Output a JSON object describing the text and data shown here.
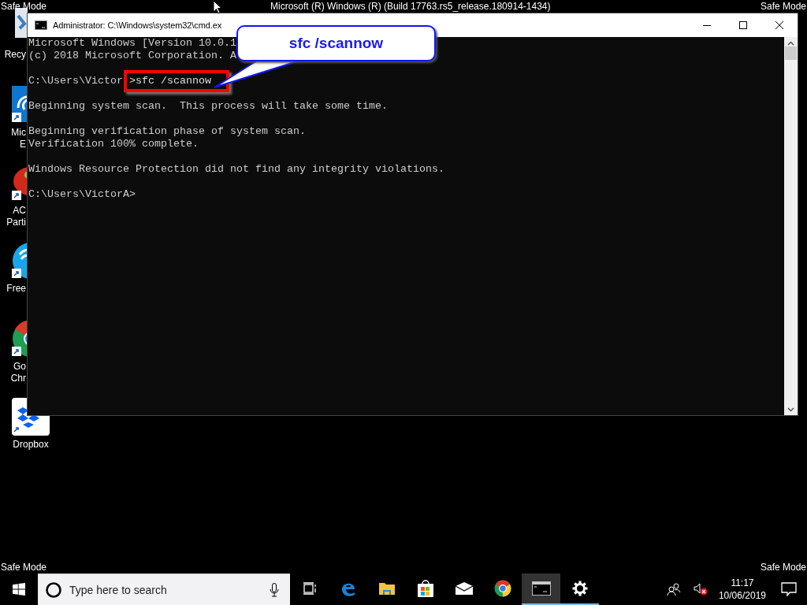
{
  "desktop": {
    "corner_top_left": "Safe Mode",
    "build": "Microsoft (R) Windows (R) (Build 17763.rs5_release.180914-1434)",
    "corner_top_right": "Safe Mode",
    "corner_bottom_left": "Safe Mode",
    "corner_bottom_right": "Safe Mode",
    "icons": [
      {
        "kind": "recycle",
        "label_lines": [
          "Recy"
        ]
      },
      {
        "kind": "edge",
        "label_lines": [
          "Mic",
          "E"
        ]
      },
      {
        "kind": "partition",
        "label_lines": [
          "AC",
          "Parti"
        ]
      },
      {
        "kind": "wifi",
        "label_lines": [
          "Free"
        ]
      },
      {
        "kind": "chrome",
        "label_lines": [
          "Go",
          "Chr"
        ]
      },
      {
        "kind": "dropbox",
        "label_lines": [
          "Dropbox"
        ]
      }
    ]
  },
  "window": {
    "title": "Administrator: C:\\Windows\\system32\\cmd.ex",
    "console_lines": [
      {
        "kind": "text",
        "text": "Microsoft Windows [Version 10.0.1"
      },
      {
        "kind": "text",
        "text": "(c) 2018 Microsoft Corporation. A"
      },
      {
        "kind": "blank"
      },
      {
        "kind": "command",
        "prompt": "C:\\Users\\Victor",
        "command": ">sfc /scannow"
      },
      {
        "kind": "blank"
      },
      {
        "kind": "text",
        "text": "Beginning system scan.  This process will take some time."
      },
      {
        "kind": "blank"
      },
      {
        "kind": "text",
        "text": "Beginning verification phase of system scan."
      },
      {
        "kind": "text",
        "text": "Verification 100% complete."
      },
      {
        "kind": "blank"
      },
      {
        "kind": "text",
        "text": "Windows Resource Protection did not find any integrity violations."
      },
      {
        "kind": "blank"
      },
      {
        "kind": "text",
        "text": "C:\\Users\\VictorA>"
      }
    ]
  },
  "callout": {
    "text": "sfc /scannow"
  },
  "taskbar": {
    "search": {
      "placeholder": "Type here to search"
    },
    "apps": [
      {
        "kind": "taskview",
        "running": false,
        "selected": false
      },
      {
        "kind": "edge",
        "running": false,
        "selected": false
      },
      {
        "kind": "explorer",
        "running": false,
        "selected": false
      },
      {
        "kind": "store",
        "running": false,
        "selected": false
      },
      {
        "kind": "mail",
        "running": false,
        "selected": false
      },
      {
        "kind": "chrome",
        "running": false,
        "selected": false
      },
      {
        "kind": "cmd",
        "running": true,
        "selected": true
      },
      {
        "kind": "settings",
        "running": true,
        "selected": false
      }
    ],
    "volume_muted": true,
    "clock": {
      "time": "11:17",
      "date": "10/06/2019"
    }
  }
}
